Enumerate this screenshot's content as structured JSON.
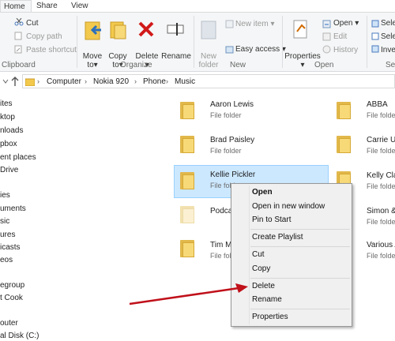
{
  "tabs": [
    "Home",
    "Share",
    "View"
  ],
  "ribbon": {
    "clipboard": {
      "cut": "Cut",
      "copy_path": "Copy path",
      "paste_shortcut": "Paste shortcut",
      "label": "Clipboard"
    },
    "organize": {
      "move_to": "Move",
      "move_to2": "to",
      "copy_to": "Copy",
      "copy_to2": "to",
      "delete": "Delete",
      "rename": "Rename",
      "label": "Organize"
    },
    "new": {
      "new_folder": "New",
      "new_folder2": "folder",
      "new_item": "New item",
      "easy_access": "Easy access",
      "label": "New"
    },
    "open": {
      "properties": "Properties",
      "open": "Open",
      "edit": "Edit",
      "history": "History",
      "label": "Open"
    },
    "select": {
      "select_all": "Selec",
      "select_none": "Selec",
      "invert": "Inver",
      "label": "Se"
    }
  },
  "address": {
    "crumbs": [
      "Computer",
      "Nokia 920",
      "Phone",
      "Music"
    ]
  },
  "nav": {
    "items": [
      "ites",
      "ktop",
      "nloads",
      "pbox",
      "ent places",
      "Drive",
      "ies",
      "uments",
      "sic",
      "ures",
      "icasts",
      "eos",
      "egroup",
      "t Cook",
      "outer",
      "al Disk (C:)"
    ]
  },
  "folders": [
    {
      "name": "Aaron Lewis",
      "type": "File folder"
    },
    {
      "name": "ABBA",
      "type": "File folder"
    },
    {
      "name": "Brad Paisley",
      "type": "File folder"
    },
    {
      "name": "Carrie Ur",
      "type": "File folder"
    },
    {
      "name": "Kellie Pickler",
      "type": "File fold"
    },
    {
      "name": "Kelly Cla",
      "type": "File folde"
    },
    {
      "name": "Podca",
      "type": ""
    },
    {
      "name": "Simon &",
      "type": "File folde"
    },
    {
      "name": "Tim M",
      "type": "File fold"
    },
    {
      "name": "Various A",
      "type": "File folde"
    }
  ],
  "context_menu": {
    "items": [
      "Open",
      "Open in new window",
      "Pin to Start",
      "Create Playlist",
      "Cut",
      "Copy",
      "Delete",
      "Rename",
      "Properties"
    ]
  },
  "colors": {
    "arrow": "#c0101a",
    "selection": "#cce8ff",
    "folder": "#f7d978"
  }
}
